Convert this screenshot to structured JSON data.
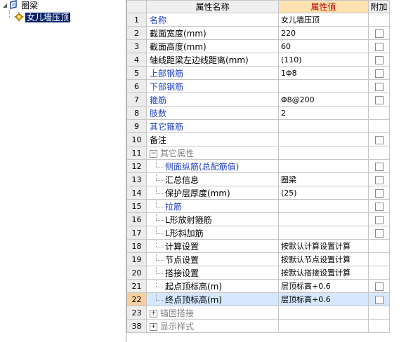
{
  "tree": {
    "root_label": "圈梁",
    "child_label": "女儿墙压顶"
  },
  "grid": {
    "headers": {
      "name": "属性名称",
      "value": "属性值",
      "extra": "附加"
    },
    "rows": [
      {
        "num": "1",
        "name": "名称",
        "value": "女儿墙压顶",
        "style": "blue",
        "cb": false,
        "indent": false,
        "toggle": ""
      },
      {
        "num": "2",
        "name": "截面宽度(mm)",
        "value": "220",
        "style": "",
        "cb": true,
        "indent": false,
        "toggle": ""
      },
      {
        "num": "3",
        "name": "截面高度(mm)",
        "value": "60",
        "style": "",
        "cb": true,
        "indent": false,
        "toggle": ""
      },
      {
        "num": "4",
        "name": "轴线距梁左边线距离(mm)",
        "value": "(110)",
        "style": "",
        "cb": true,
        "indent": false,
        "toggle": ""
      },
      {
        "num": "5",
        "name": "上部钢筋",
        "value": "1Φ8",
        "style": "blue",
        "cb": true,
        "indent": false,
        "toggle": ""
      },
      {
        "num": "6",
        "name": "下部钢筋",
        "value": "",
        "style": "blue",
        "cb": true,
        "indent": false,
        "toggle": ""
      },
      {
        "num": "7",
        "name": "箍筋",
        "value": "Φ8@200",
        "style": "blue",
        "cb": true,
        "indent": false,
        "toggle": ""
      },
      {
        "num": "8",
        "name": "肢数",
        "value": "2",
        "style": "blue",
        "cb": false,
        "indent": false,
        "toggle": ""
      },
      {
        "num": "9",
        "name": "其它箍筋",
        "value": "",
        "style": "blue",
        "cb": false,
        "indent": false,
        "toggle": ""
      },
      {
        "num": "10",
        "name": "备注",
        "value": "",
        "style": "",
        "cb": true,
        "indent": false,
        "toggle": ""
      },
      {
        "num": "11",
        "name": "其它属性",
        "value": "",
        "style": "gray",
        "cb": false,
        "indent": false,
        "toggle": "−"
      },
      {
        "num": "12",
        "name": "侧面纵筋(总配筋值)",
        "value": "",
        "style": "blue",
        "cb": true,
        "indent": true,
        "toggle": ""
      },
      {
        "num": "13",
        "name": "汇总信息",
        "value": "圈梁",
        "style": "",
        "cb": true,
        "indent": true,
        "toggle": ""
      },
      {
        "num": "14",
        "name": "保护层厚度(mm)",
        "value": "(25)",
        "style": "",
        "cb": true,
        "indent": true,
        "toggle": ""
      },
      {
        "num": "15",
        "name": "拉筋",
        "value": "",
        "style": "blue",
        "cb": true,
        "indent": true,
        "toggle": ""
      },
      {
        "num": "16",
        "name": "L形放射箍筋",
        "value": "",
        "style": "",
        "cb": true,
        "indent": true,
        "toggle": ""
      },
      {
        "num": "17",
        "name": "L形斜加筋",
        "value": "",
        "style": "",
        "cb": true,
        "indent": true,
        "toggle": ""
      },
      {
        "num": "18",
        "name": "计算设置",
        "value": "按默认计算设置计算",
        "style": "",
        "cb": false,
        "indent": true,
        "toggle": ""
      },
      {
        "num": "19",
        "name": "节点设置",
        "value": "按默认节点设置计算",
        "style": "",
        "cb": false,
        "indent": true,
        "toggle": ""
      },
      {
        "num": "20",
        "name": "搭接设置",
        "value": "按默认搭接设置计算",
        "style": "",
        "cb": false,
        "indent": true,
        "toggle": ""
      },
      {
        "num": "21",
        "name": "起点顶标高(m)",
        "value": "层顶标高+0.6",
        "style": "",
        "cb": true,
        "indent": true,
        "toggle": ""
      },
      {
        "num": "22",
        "name": "终点顶标高(m)",
        "value": "层顶标高+0.6",
        "style": "",
        "cb": true,
        "indent": true,
        "toggle": "",
        "selected": true
      },
      {
        "num": "23",
        "name": "锚固搭接",
        "value": "",
        "style": "gray",
        "cb": false,
        "indent": false,
        "toggle": "+"
      },
      {
        "num": "38",
        "name": "显示样式",
        "value": "",
        "style": "gray",
        "cb": false,
        "indent": false,
        "toggle": "+"
      }
    ]
  }
}
